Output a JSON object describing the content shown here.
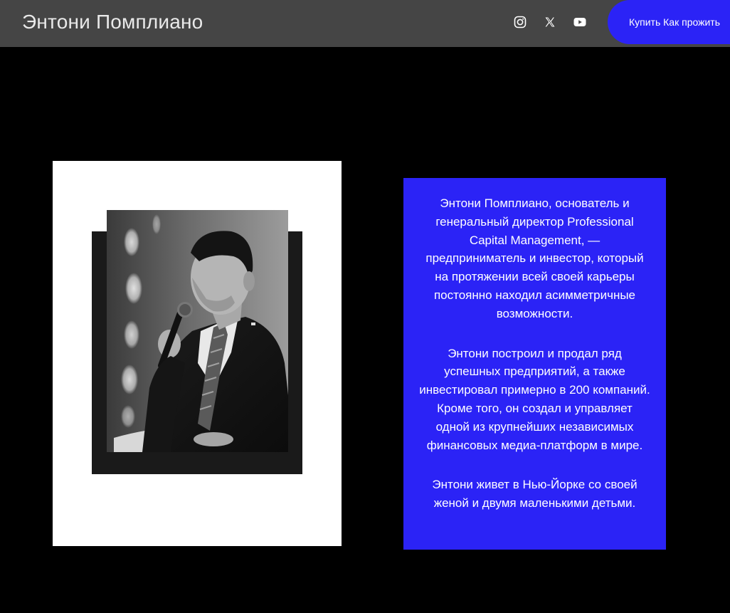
{
  "header": {
    "site_title": "Энтони Помплиано",
    "social_icons": [
      "instagram-icon",
      "x-icon",
      "youtube-icon"
    ],
    "cta_label": "Купить Как прожить"
  },
  "hero": {
    "photo_alt": "Энтони Помплиано"
  },
  "bio": {
    "paragraphs": [
      "Энтони Помплиано, основатель и генеральный директор Professional Capital Management, — предприниматель и инвестор, который на протяжении всей своей карьеры постоянно находил асимметричные возможности.",
      "Энтони построил и продал ряд успешных предприятий, а также инвестировал примерно в 200 компаний. Кроме того, он создал и управляет одной из крупнейших независимых финансовых медиа-платформ в мире.",
      "Энтони живет в Нью-Йорке со своей женой и двумя маленькими детьми."
    ]
  },
  "colors": {
    "header_bg": "#454545",
    "page_bg": "#000000",
    "accent_blue": "#2b23f6",
    "card_white": "#ffffff"
  }
}
